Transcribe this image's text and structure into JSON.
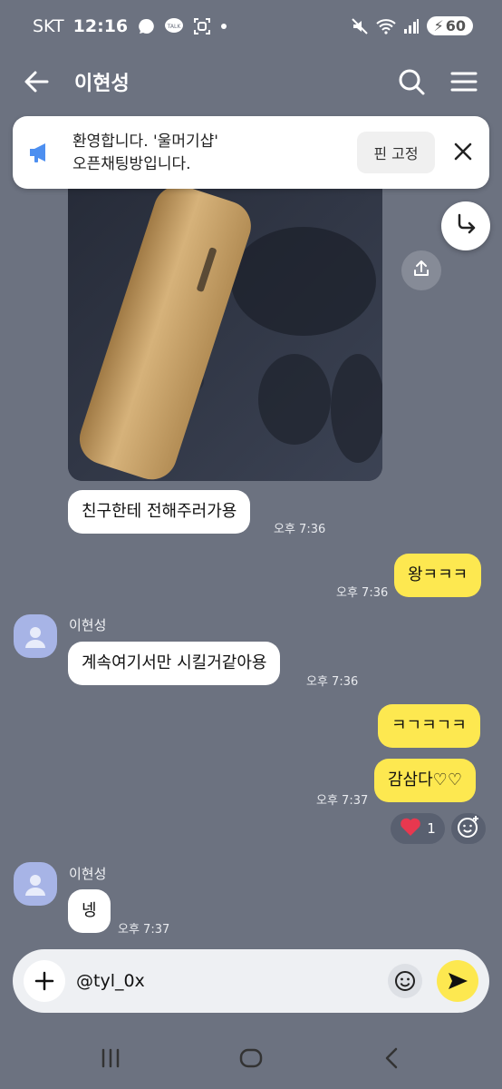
{
  "status_bar": {
    "carrier": "SKT",
    "time": "12:16",
    "battery": "60",
    "left_icons": [
      "talk-bubble-icon",
      "kakaotalk-icon",
      "screenshot-icon",
      "dot-icon"
    ],
    "right_icons": [
      "mute-icon",
      "wifi-icon",
      "signal-icon",
      "battery-icon"
    ]
  },
  "header": {
    "title": "이현성",
    "icons": [
      "back-arrow-icon",
      "search-icon",
      "menu-icon"
    ]
  },
  "notice": {
    "line1": "환영합니다. '울머기샵'",
    "line2": "오픈채팅방입니다.",
    "pin_label": "핀 고정",
    "icons": [
      "megaphone-icon",
      "close-icon"
    ]
  },
  "messages": [
    {
      "side": "in",
      "text": "친구한테 전해주러가용",
      "time": "오후 7:36"
    },
    {
      "side": "out",
      "text": "왕ㅋㅋㅋ",
      "time": "오후 7:36"
    },
    {
      "side": "in",
      "sender": "이현성",
      "text": "계속여기서만 시킬거같아용",
      "time": "오후 7:36"
    },
    {
      "side": "out",
      "text": "ㅋㄱㅋㄱㅋ",
      "time": ""
    },
    {
      "side": "out",
      "text": "감삼다♡♡",
      "time": "오후 7:37"
    },
    {
      "side": "in",
      "sender": "이현성",
      "text": "넹",
      "time": "오후 7:37"
    }
  ],
  "reaction": {
    "count": "1",
    "icon": "heart-icon"
  },
  "input": {
    "value": "@tyl_0x",
    "icons": [
      "plus-icon",
      "emoji-icon",
      "send-icon"
    ]
  },
  "colors": {
    "background": "#6c7280",
    "outgoing_bubble": "#fde850",
    "incoming_bubble": "#ffffff",
    "avatar": "#a7b4e6",
    "heart": "#e8384f"
  },
  "nav_icons": [
    "recent-apps-icon",
    "home-icon",
    "back-icon"
  ]
}
